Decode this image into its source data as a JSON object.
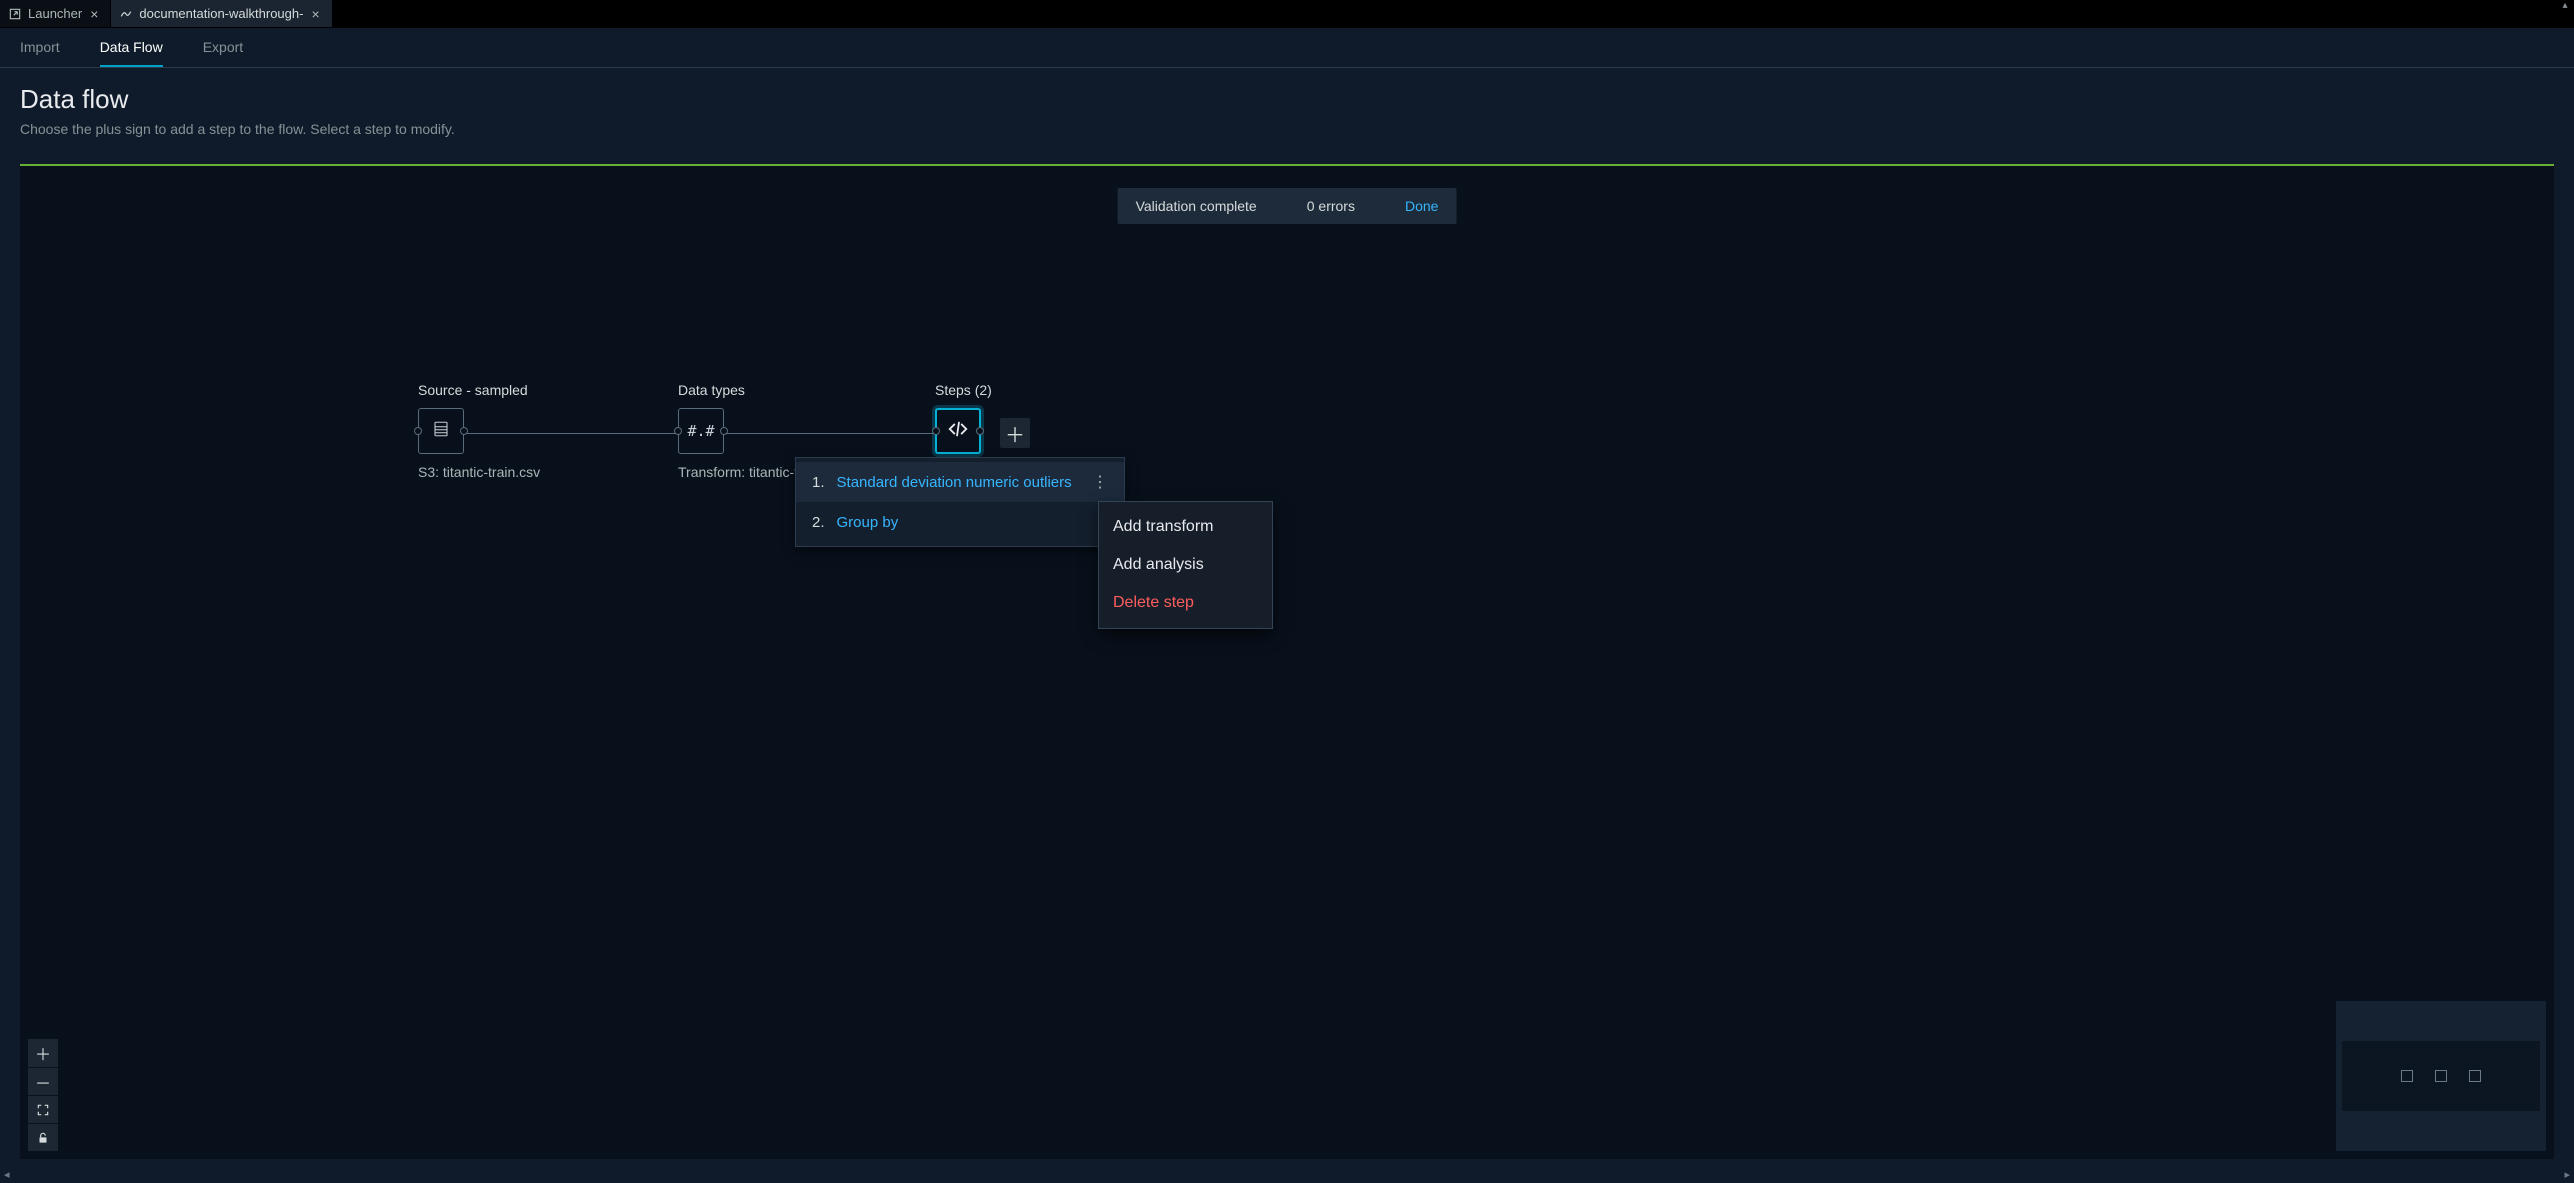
{
  "tabs": [
    {
      "label": "Launcher",
      "active": false
    },
    {
      "label": "documentation-walkthrough-",
      "active": true
    }
  ],
  "subnav": {
    "import": "Import",
    "dataflow": "Data Flow",
    "export": "Export"
  },
  "header": {
    "title": "Data flow",
    "subtitle": "Choose the plus sign to add a step to the flow. Select a step to modify."
  },
  "toast": {
    "message": "Validation complete",
    "errors": "0 errors",
    "done": "Done"
  },
  "nodes": {
    "source": {
      "title": "Source - sampled",
      "sub": "S3: titantic-train.csv"
    },
    "types": {
      "title": "Data types",
      "glyph": "#.#",
      "sub": "Transform: titantic-t"
    },
    "steps": {
      "title": "Steps (2)"
    }
  },
  "steps_panel": [
    {
      "idx": "1.",
      "label": "Standard deviation numeric outliers"
    },
    {
      "idx": "2.",
      "label": "Group by"
    }
  ],
  "context_menu": {
    "add_transform": "Add transform",
    "add_analysis": "Add analysis",
    "delete_step": "Delete step"
  }
}
